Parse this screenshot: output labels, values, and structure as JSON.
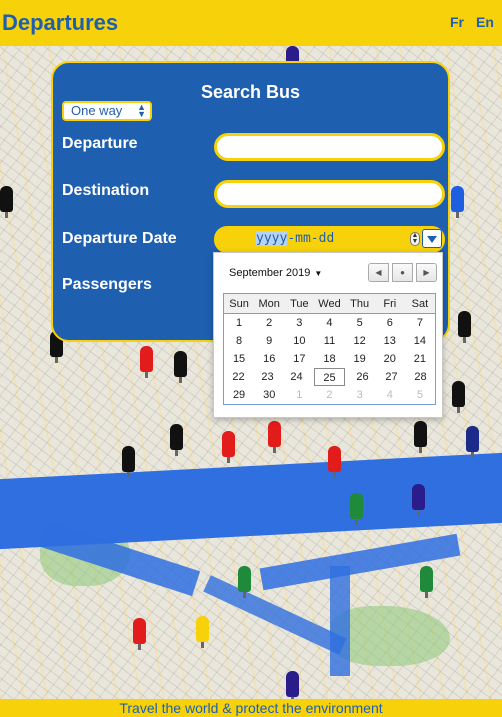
{
  "header": {
    "title": "Departures",
    "lang_fr": "Fr",
    "lang_en": "En"
  },
  "footer": {
    "text": "Travel the world & protect the environment"
  },
  "search": {
    "title": "Search Bus",
    "trip_type": "One way",
    "departure_label": "Departure",
    "destination_label": "Destination",
    "date_label": "Departure Date",
    "passengers_label": "Passengers",
    "departure_value": "",
    "destination_value": "",
    "date_placeholder_year": "yyyy",
    "date_placeholder_rest": "-mm-dd"
  },
  "calendar": {
    "month_label": "September 2019",
    "weekdays": [
      "Sun",
      "Mon",
      "Tue",
      "Wed",
      "Thu",
      "Fri",
      "Sat"
    ],
    "weeks": [
      [
        "1",
        "2",
        "3",
        "4",
        "5",
        "6",
        "7"
      ],
      [
        "8",
        "9",
        "10",
        "11",
        "12",
        "13",
        "14"
      ],
      [
        "15",
        "16",
        "17",
        "18",
        "19",
        "20",
        "21"
      ],
      [
        "22",
        "23",
        "24",
        "25",
        "26",
        "27",
        "28"
      ],
      [
        "29",
        "30",
        "1",
        "2",
        "3",
        "4",
        "5"
      ]
    ],
    "selected_day": "25"
  },
  "colors": {
    "brand_blue": "#1e5fb0",
    "brand_yellow": "#f7d20a",
    "water": "#2f6fe0"
  }
}
